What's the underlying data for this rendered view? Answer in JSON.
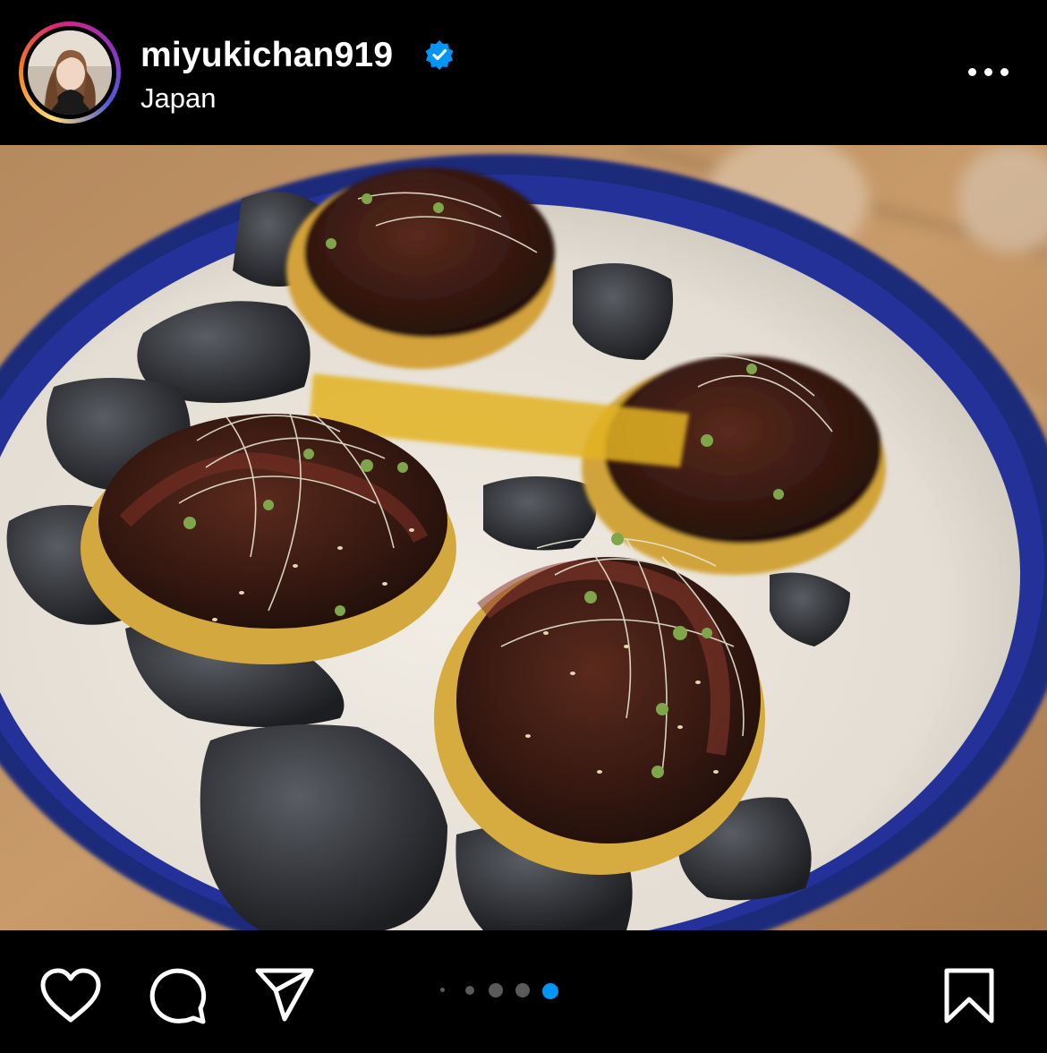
{
  "post": {
    "username": "miyukichan919",
    "location": "Japan",
    "verified": true
  },
  "icons": {
    "verified": "verified-badge-icon",
    "more": "more-horizontal-icon",
    "like": "heart-icon",
    "comment": "comment-bubble-icon",
    "share": "paper-plane-icon",
    "save": "bookmark-icon"
  },
  "carousel": {
    "total_dots_visible": 5,
    "active_index": 5
  },
  "colors": {
    "background": "#000000",
    "text": "#ffffff",
    "verified_blue": "#0095f6",
    "active_dot": "#0095f6",
    "inactive_dot": "#5a5a5a"
  }
}
